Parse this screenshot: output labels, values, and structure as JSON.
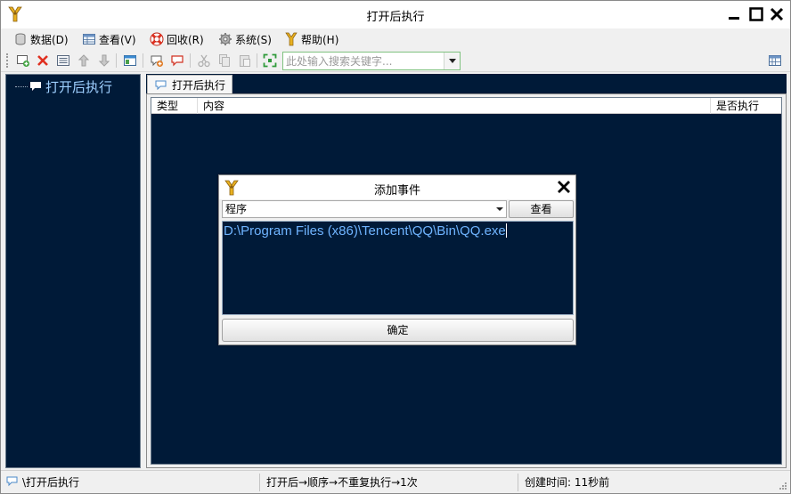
{
  "window": {
    "title": "打开后执行"
  },
  "menu": {
    "items": [
      {
        "label": "数据(D)",
        "icon": "database-icon"
      },
      {
        "label": "查看(V)",
        "icon": "view-table-icon"
      },
      {
        "label": "回收(R)",
        "icon": "lifebuoy-icon"
      },
      {
        "label": "系统(S)",
        "icon": "gear-icon"
      },
      {
        "label": "帮助(H)",
        "icon": "app-logo-icon"
      }
    ]
  },
  "toolbar": {
    "search_placeholder": "此处输入搜索关键字..."
  },
  "tree": {
    "items": [
      {
        "label": "打开后执行"
      }
    ]
  },
  "tabs": [
    {
      "label": "打开后执行"
    }
  ],
  "grid": {
    "columns": [
      "类型",
      "内容",
      "是否执行"
    ]
  },
  "dialog": {
    "title": "添加事件",
    "type_select": "程序",
    "view_button": "查看",
    "path": "D:\\Program Files (x86)\\Tencent\\QQ\\Bin\\QQ.exe",
    "ok_button": "确定"
  },
  "status": {
    "path": "\\打开后执行",
    "rule": "打开后→顺序→不重复执行→1次",
    "created": "创建时间: 11秒前"
  },
  "colors": {
    "panel_bg": "#001a38",
    "tree_text": "#9fd0ff",
    "path_text": "#6fb4ff",
    "delete_red": "#e03020",
    "search_border": "#7fc27f"
  }
}
